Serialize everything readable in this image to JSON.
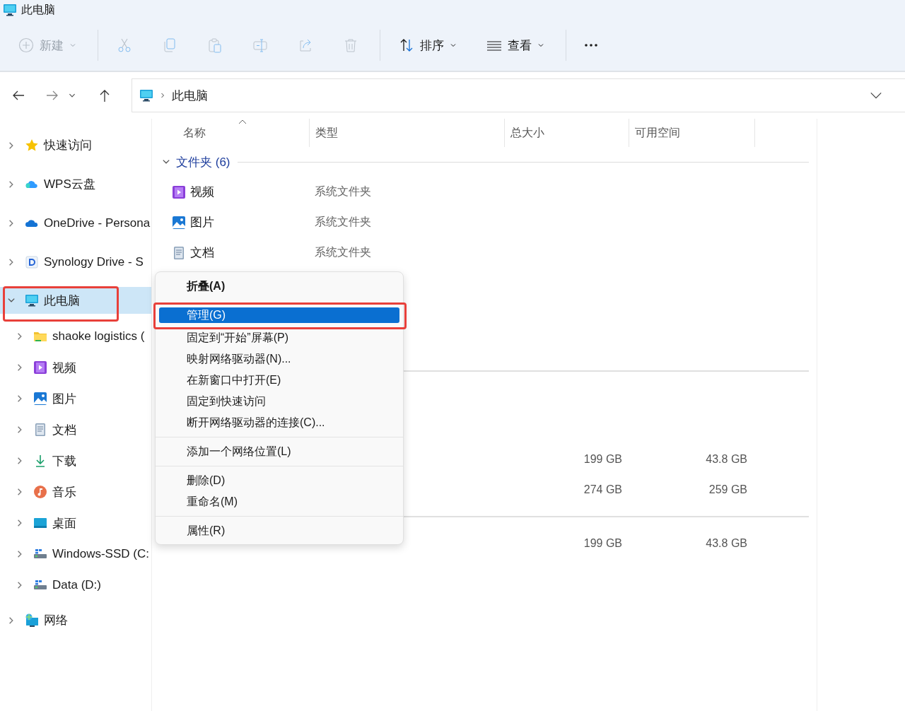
{
  "window": {
    "title": "此电脑"
  },
  "toolbar": [
    {
      "kind": "new",
      "label": "新建",
      "disabled": true
    },
    {
      "kind": "cut",
      "disabled": true
    },
    {
      "kind": "copy",
      "disabled": true
    },
    {
      "kind": "paste",
      "disabled": true
    },
    {
      "kind": "rename",
      "disabled": true
    },
    {
      "kind": "share",
      "disabled": true
    },
    {
      "kind": "delete",
      "disabled": true
    },
    {
      "kind": "sort",
      "label": "排序",
      "disabled": false
    },
    {
      "kind": "view",
      "label": "查看",
      "disabled": false
    },
    {
      "kind": "more",
      "disabled": false
    }
  ],
  "address": {
    "path": "此电脑"
  },
  "sidebar": {
    "items": [
      {
        "label": "快速访问",
        "kind": "star",
        "expanded": false,
        "selected": false,
        "highlighted": false
      },
      {
        "label": "WPS云盘",
        "kind": "wps",
        "expanded": false,
        "selected": false,
        "highlighted": false
      },
      {
        "label": "OneDrive - Persona",
        "kind": "onedrive",
        "expanded": false,
        "selected": false,
        "highlighted": false
      },
      {
        "label": "Synology Drive - S",
        "kind": "synology",
        "expanded": false,
        "selected": false,
        "highlighted": false
      },
      {
        "label": "此电脑",
        "kind": "pc",
        "expanded": true,
        "selected": true,
        "highlighted": true,
        "children": [
          {
            "label": "shaoke logistics (",
            "kind": "folder",
            "expanded": false,
            "selected": false,
            "highlighted": false
          },
          {
            "label": "视频",
            "kind": "video",
            "expanded": false,
            "selected": false,
            "highlighted": false
          },
          {
            "label": "图片",
            "kind": "picture",
            "expanded": false,
            "selected": false,
            "highlighted": false
          },
          {
            "label": "文档",
            "kind": "document",
            "expanded": false,
            "selected": false,
            "highlighted": false
          },
          {
            "label": "下载",
            "kind": "download",
            "expanded": false,
            "selected": false,
            "highlighted": false
          },
          {
            "label": "音乐",
            "kind": "music",
            "expanded": false,
            "selected": false,
            "highlighted": false
          },
          {
            "label": "桌面",
            "kind": "desktop",
            "expanded": false,
            "selected": false,
            "highlighted": false
          },
          {
            "label": "Windows-SSD (C:",
            "kind": "drive",
            "expanded": false,
            "selected": false,
            "highlighted": false
          },
          {
            "label": "Data (D:)",
            "kind": "drive",
            "expanded": false,
            "selected": false,
            "highlighted": false
          }
        ]
      },
      {
        "label": "网络",
        "kind": "network",
        "expanded": false,
        "selected": false,
        "highlighted": false
      }
    ]
  },
  "table": {
    "columns": [
      {
        "label": "名称",
        "sorted": true
      },
      {
        "label": "类型",
        "sorted": false
      },
      {
        "label": "总大小",
        "sorted": false
      },
      {
        "label": "可用空间",
        "sorted": false
      }
    ],
    "group": {
      "label": "文件夹 (6)",
      "expanded": true
    },
    "folders": [
      {
        "name": "视频",
        "kind": "video",
        "type": "系统文件夹"
      },
      {
        "name": "图片",
        "kind": "picture",
        "type": "系统文件夹"
      },
      {
        "name": "文档",
        "kind": "document",
        "type": "系统文件夹"
      }
    ],
    "drives": [
      {
        "total": "199 GB",
        "free": "43.8 GB"
      },
      {
        "total": "274 GB",
        "free": "259 GB"
      }
    ],
    "locations": [
      {
        "total": "199 GB",
        "free": "43.8 GB"
      }
    ]
  },
  "context_menu": {
    "sections": [
      [
        {
          "label": "折叠(A)",
          "default": true,
          "selected": false,
          "highlighted": false
        }
      ],
      [
        {
          "label": "管理(G)",
          "default": false,
          "selected": true,
          "highlighted": true
        },
        {
          "label": "固定到“开始”屏幕(P)",
          "default": false,
          "selected": false,
          "highlighted": false
        },
        {
          "label": "映射网络驱动器(N)...",
          "default": false,
          "selected": false,
          "highlighted": false
        },
        {
          "label": "在新窗口中打开(E)",
          "default": false,
          "selected": false,
          "highlighted": false
        },
        {
          "label": "固定到快速访问",
          "default": false,
          "selected": false,
          "highlighted": false
        },
        {
          "label": "断开网络驱动器的连接(C)...",
          "default": false,
          "selected": false,
          "highlighted": false
        }
      ],
      [
        {
          "label": "添加一个网络位置(L)",
          "default": false,
          "selected": false,
          "highlighted": false
        }
      ],
      [
        {
          "label": "删除(D)",
          "default": false,
          "selected": false,
          "highlighted": false
        },
        {
          "label": "重命名(M)",
          "default": false,
          "selected": false,
          "highlighted": false
        }
      ],
      [
        {
          "label": "属性(R)",
          "default": false,
          "selected": false,
          "highlighted": false
        }
      ]
    ]
  }
}
